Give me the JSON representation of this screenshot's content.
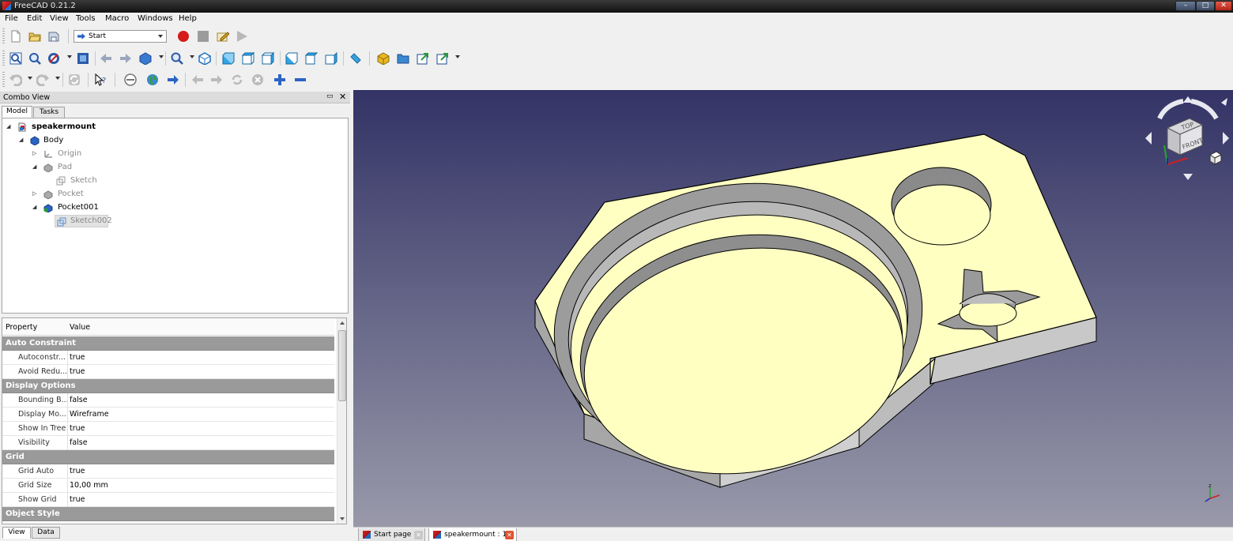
{
  "window": {
    "title": "FreeCAD 0.21.2",
    "min": "–",
    "max": "□",
    "close": "✕"
  },
  "menu": [
    "File",
    "Edit",
    "View",
    "Tools",
    "Macro",
    "Windows",
    "Help"
  ],
  "toolbar": {
    "macro_select": "Start"
  },
  "combo": {
    "title": "Combo View",
    "float_icon": "▭",
    "close_icon": "✕",
    "tabs": [
      "Model",
      "Tasks"
    ],
    "bottom_tabs": [
      "View",
      "Data"
    ]
  },
  "tree": {
    "items": [
      {
        "label": "speakermount"
      },
      {
        "label": "Body"
      },
      {
        "label": "Origin"
      },
      {
        "label": "Pad"
      },
      {
        "label": "Sketch"
      },
      {
        "label": "Pocket"
      },
      {
        "label": "Pocket001"
      },
      {
        "label": "Sketch002"
      }
    ]
  },
  "properties": {
    "col_property": "Property",
    "col_value": "Value",
    "groups": {
      "auto": "Auto Constraint",
      "display": "Display Options",
      "grid": "Grid",
      "style": "Object Style"
    },
    "rows": [
      {
        "name": "Autoconstr...",
        "value": "true"
      },
      {
        "name": "Avoid Redu...",
        "value": "true"
      },
      {
        "name": "Bounding B...",
        "value": "false"
      },
      {
        "name": "Display Mo...",
        "value": "Wireframe"
      },
      {
        "name": "Show In Tree",
        "value": "true"
      },
      {
        "name": "Visibility",
        "value": "false"
      },
      {
        "name": "Grid Auto",
        "value": "true"
      },
      {
        "name": "Grid Size",
        "value": "10,00 mm"
      },
      {
        "name": "Show Grid",
        "value": "true"
      }
    ]
  },
  "navcube": {
    "top": "TOP",
    "front": "FRONT"
  },
  "doc_tabs": [
    {
      "label": "Start page"
    },
    {
      "label": "speakermount : 1"
    }
  ],
  "colors": {
    "face": "#ffffc2",
    "wall": "#b8b8b8",
    "bg_top": "#333366",
    "bg_bottom": "#9999aa"
  }
}
